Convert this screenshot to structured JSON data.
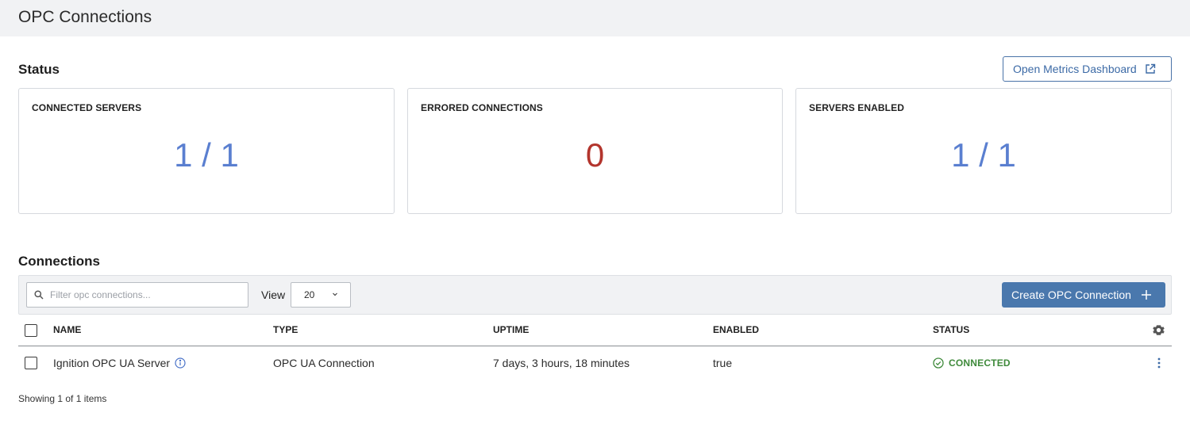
{
  "page": {
    "title": "OPC Connections"
  },
  "status_section": {
    "title": "Status",
    "metrics_button": "Open Metrics Dashboard",
    "cards": [
      {
        "label": "CONNECTED SERVERS",
        "value": "1 / 1"
      },
      {
        "label": "ERRORED CONNECTIONS",
        "value": "0"
      },
      {
        "label": "SERVERS ENABLED",
        "value": "1 / 1"
      }
    ]
  },
  "connections_section": {
    "title": "Connections",
    "filter_placeholder": "Filter opc connections...",
    "view_label": "View",
    "view_value": "20",
    "create_button": "Create OPC Connection",
    "columns": [
      "NAME",
      "TYPE",
      "UPTIME",
      "ENABLED",
      "STATUS"
    ],
    "rows": [
      {
        "name": "Ignition OPC UA Server",
        "type": "OPC UA Connection",
        "uptime": "7 days, 3 hours, 18 minutes",
        "enabled": "true",
        "status": "CONNECTED"
      }
    ],
    "footer": "Showing 1 of 1 items"
  },
  "colors": {
    "accent": "#4a78ad",
    "metric_value": "#5a7fd0",
    "error_value": "#b3352d",
    "connected": "#3f8a3b"
  },
  "icons": [
    "external-link-icon",
    "search-icon",
    "chevron-down-icon",
    "plus-icon",
    "info-icon",
    "settings-gear-icon",
    "check-circle-icon",
    "kebab-menu-icon"
  ]
}
